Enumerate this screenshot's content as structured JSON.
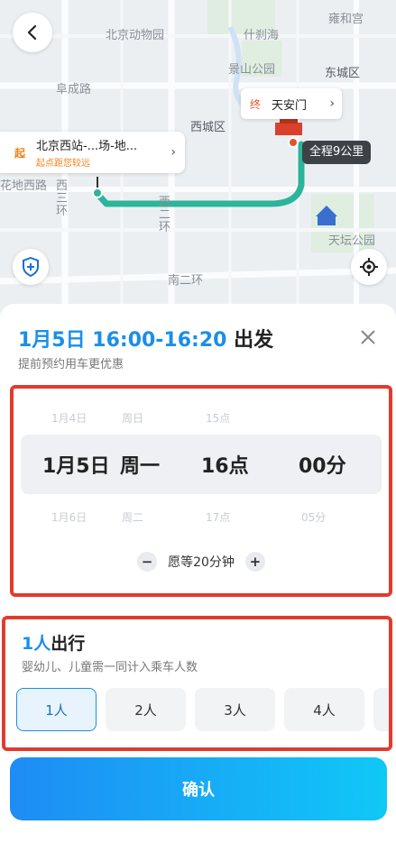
{
  "map": {
    "labels": {
      "zoo": "北京动物园",
      "shichahai": "什刹海",
      "yonghegong": "雍和宫",
      "jingshan": "景山公园",
      "dongcheng": "东城区",
      "fuchenglu": "阜成路",
      "xicheng": "西城区",
      "xizhimen": "西",
      "xisanhuan_top": "花地西路",
      "xisanhuan_v": "西三环",
      "xierhuan_v": "西二环",
      "tiantan": "天坛公园",
      "nanerhuan": "南二环"
    },
    "start": {
      "tag": "起",
      "name": "北京西站-...场-地...",
      "note": "起点距您较远"
    },
    "end": {
      "tag": "终",
      "name": "天安门"
    },
    "distance": "全程9公里"
  },
  "sheet": {
    "title_accent": "1月5日 16:00-16:20",
    "title_rest": " 出发",
    "subtitle": "提前预约用车更优惠",
    "picker": {
      "prev": {
        "date": "1月4日",
        "day": "周日",
        "hour": "15点",
        "minute": ""
      },
      "current": {
        "date": "1月5日",
        "day": "周一",
        "hour": "16点",
        "minute": "00分"
      },
      "next": {
        "date": "1月6日",
        "day": "周二",
        "hour": "17点",
        "minute": "05分"
      }
    },
    "wait_text": "愿等20分钟",
    "minus": "−",
    "plus": "+",
    "passengers": {
      "title_accent": "1人",
      "title_rest": "出行",
      "subtitle": "婴幼儿、儿童需一同计入乘车人数",
      "options": [
        "1人",
        "2人",
        "3人",
        "4人"
      ],
      "selected_index": 0
    },
    "confirm_label": "确认"
  },
  "colors": {
    "accent": "#1a8fe8",
    "route": "#2bb59a",
    "highlight_border": "#e23b2e",
    "confirm_gradient": [
      "#1e8cf5",
      "#10c8f6"
    ]
  }
}
